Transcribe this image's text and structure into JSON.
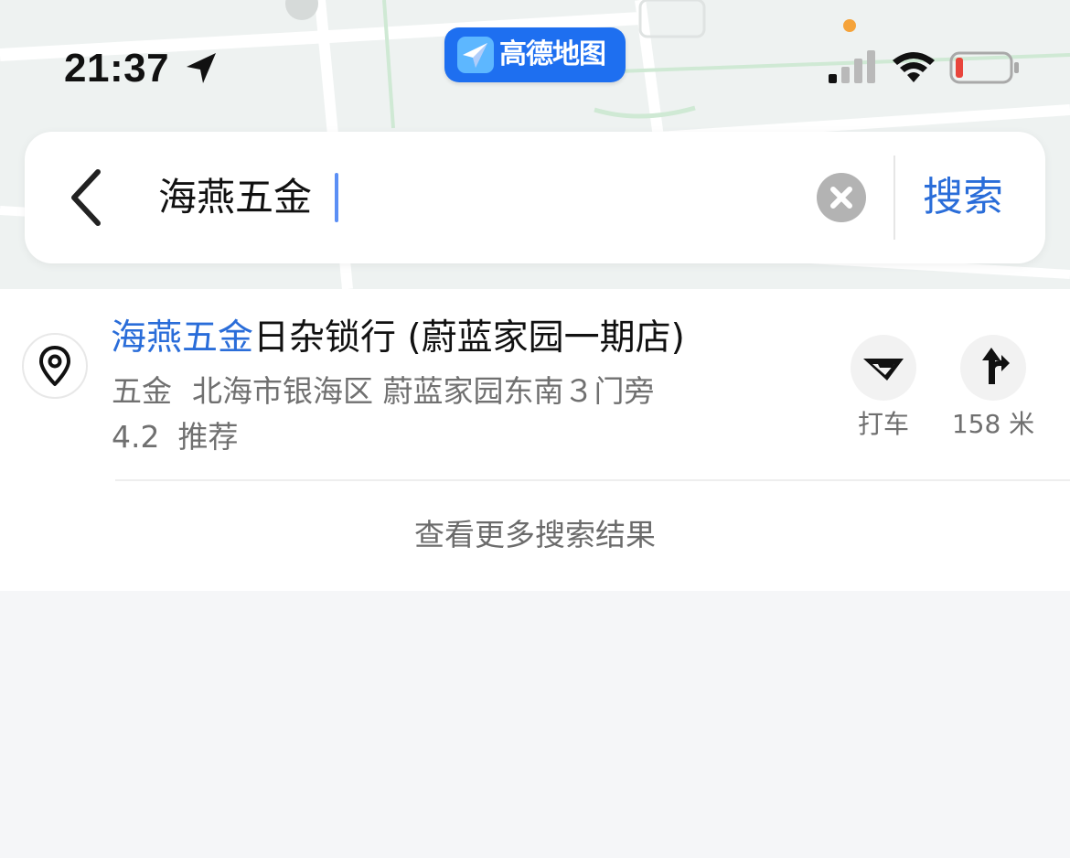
{
  "status_bar": {
    "time": "21:37",
    "app_name": "高德地图",
    "icons": [
      "location-arrow-icon",
      "signal-icon",
      "wifi-icon",
      "battery-icon"
    ],
    "battery_color": "#e8453c",
    "privacy_dot_color": "#f5a33a"
  },
  "search": {
    "back_icon": "chevron-left-icon",
    "query": "海燕五金",
    "clear_icon": "clear-icon",
    "button_label": "搜索",
    "accent_color": "#2a6dd9"
  },
  "results": [
    {
      "icon": "location-pin-icon",
      "title_highlight": "海燕五金",
      "title_rest": "日杂锁行 (蔚蓝家园一期店)",
      "category": "五金",
      "address": "北海市银海区 蔚蓝家园东南３门旁",
      "rating": "4.2",
      "tag": "推荐",
      "actions": [
        {
          "icon": "taxi-icon",
          "label": "打车"
        },
        {
          "icon": "route-arrow-icon",
          "label": "158 米"
        }
      ]
    }
  ],
  "more_results_label": "查看更多搜索结果"
}
